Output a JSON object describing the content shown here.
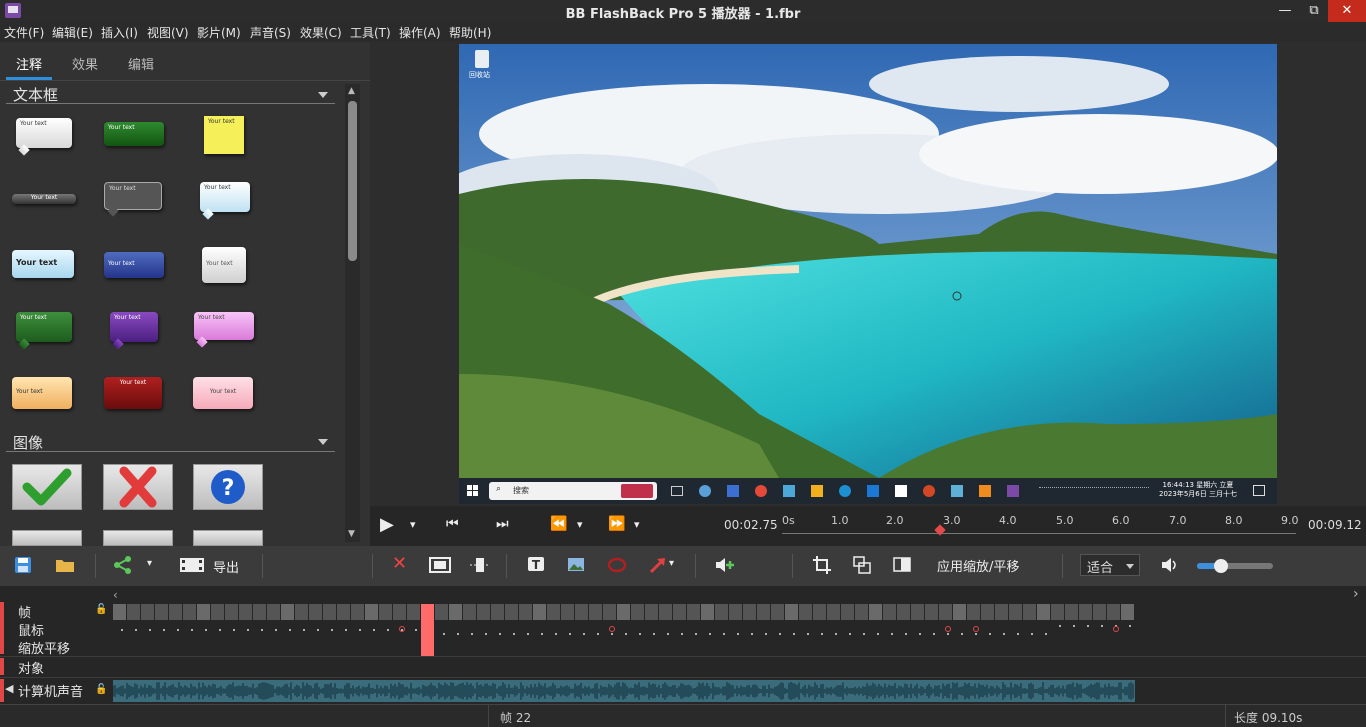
{
  "window": {
    "title": "BB FlashBack Pro 5 播放器 - 1.fbr",
    "min": "—",
    "max": "⧉",
    "close": "✕"
  },
  "menu": [
    "文件(F)",
    "编辑(E)",
    "插入(I)",
    "视图(V)",
    "影片(M)",
    "声音(S)",
    "效果(C)",
    "工具(T)",
    "操作(A)",
    "帮助(H)"
  ],
  "panel": {
    "tabs": [
      "注释",
      "效果",
      "编辑"
    ],
    "sections": {
      "textbox": "文本框",
      "images": "图像"
    },
    "annotation_text": "Your text"
  },
  "desktop": {
    "recycle_bin": "回收站",
    "search": "搜索",
    "clock_time": "16:44:13 星期六 立夏",
    "clock_date": "2023年5月6日 三月十七"
  },
  "controls": {
    "play": "▶",
    "menu_arrow": "▾",
    "start": "⏮",
    "end": "⏭",
    "prev": "⏪",
    "next": "⏩",
    "current_time": "00:02.75",
    "end_time": "00:09.12",
    "ruler_ticks": [
      "0s",
      "1.0",
      "2.0",
      "3.0",
      "4.0",
      "5.0",
      "6.0",
      "7.0",
      "8.0",
      "9.0"
    ]
  },
  "toolbar": {
    "export": "导出",
    "apply_zoom_pan": "应用缩放/平移",
    "zoom_fit": "适合"
  },
  "timeline": {
    "tracks": [
      "帧",
      "鼠标",
      "缩放平移",
      "对象"
    ],
    "audio_track": "计算机声音",
    "scroll_left": "‹",
    "scroll_right": "›"
  },
  "status": {
    "frame": "帧 22",
    "length": "长度 09.10s"
  },
  "colors": {
    "accent": "#2e8fdd",
    "playhead": "#e34b4b",
    "audio": "#3a6c7c"
  }
}
